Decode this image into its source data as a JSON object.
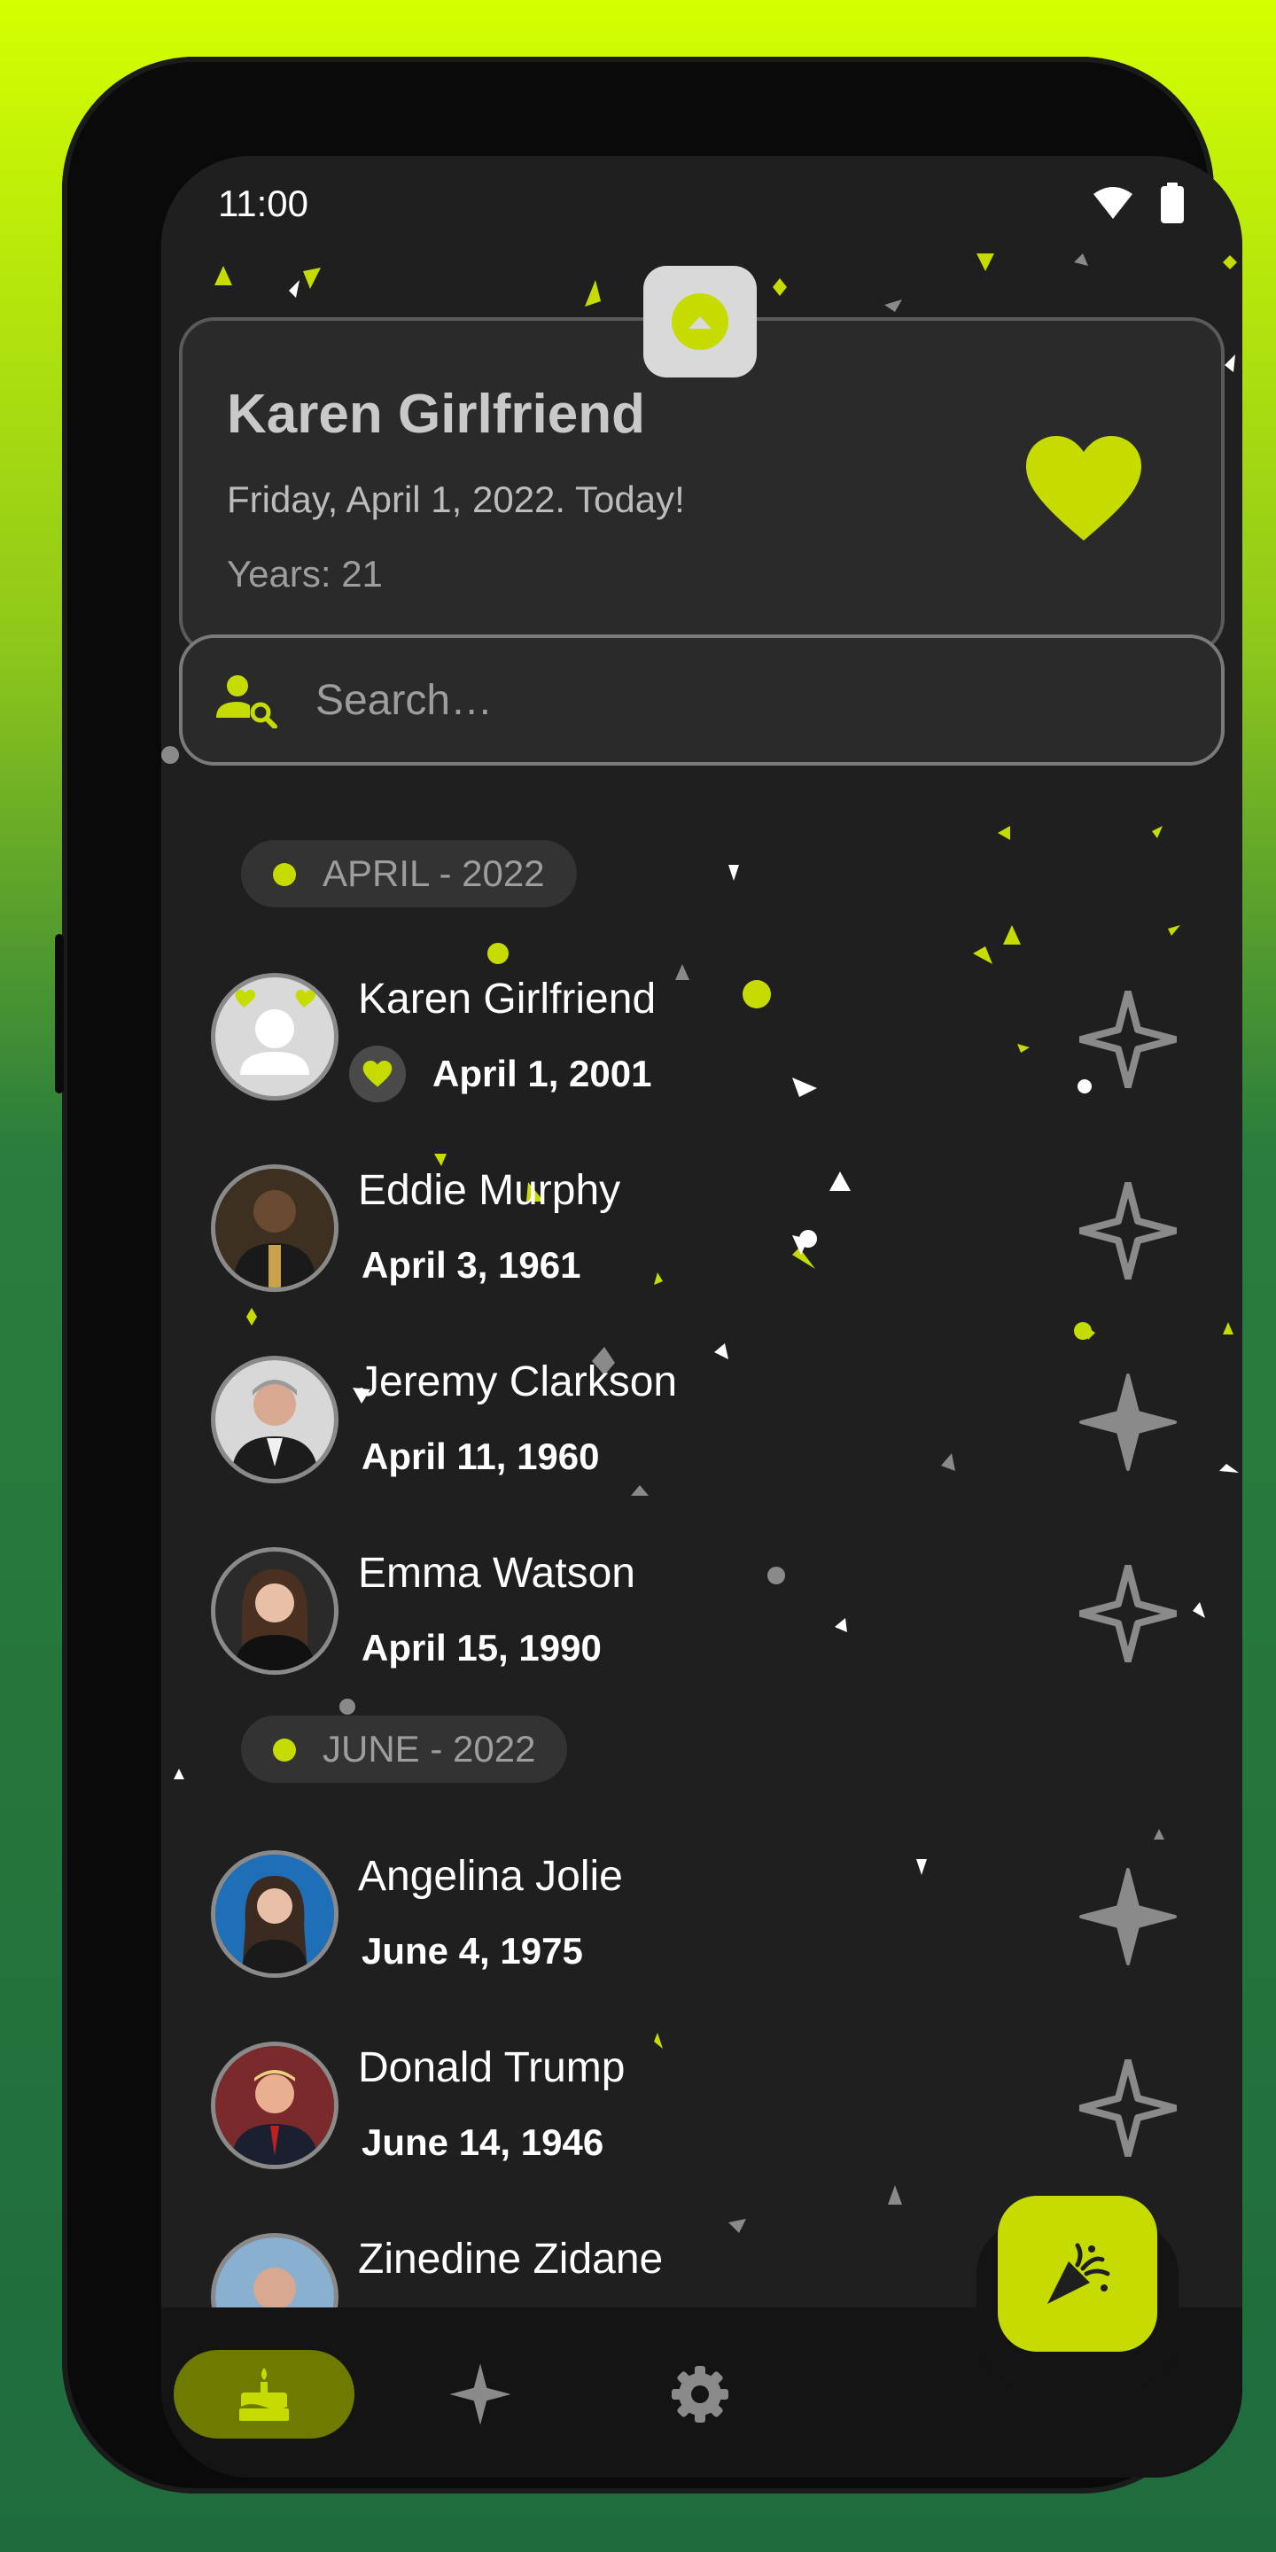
{
  "status_bar": {
    "time": "11:00"
  },
  "today_card": {
    "name": "Karen Girlfriend",
    "date_text": "Friday, April 1, 2022. Today!",
    "years_text": "Years: 21"
  },
  "search": {
    "placeholder": "Search…"
  },
  "sections": [
    {
      "month": "APRIL - 2022",
      "people": [
        {
          "name": "Karen Girlfriend",
          "date": "April 1, 2001"
        },
        {
          "name": "Eddie Murphy",
          "date": "April 3, 1961"
        },
        {
          "name": "Jeremy Clarkson",
          "date": "April 11, 1960"
        },
        {
          "name": "Emma Watson",
          "date": "April 15, 1990"
        }
      ]
    },
    {
      "month": "JUNE - 2022",
      "people": [
        {
          "name": "Angelina Jolie",
          "date": "June 4, 1975"
        },
        {
          "name": "Donald Trump",
          "date": "June 14, 1946"
        },
        {
          "name": "Zinedine Zidane",
          "date": ""
        }
      ]
    }
  ],
  "colors": {
    "accent": "#c6dc00",
    "background": "#1f1f1f",
    "card": "#2a2a2a"
  },
  "icons": {
    "wifi": "wifi-icon",
    "battery": "battery-icon",
    "heart": "heart-icon",
    "search": "person-search-icon",
    "star": "sparkle-star-icon",
    "confetti": "party-popper-icon",
    "cake": "cake-icon",
    "gear": "gear-icon"
  }
}
